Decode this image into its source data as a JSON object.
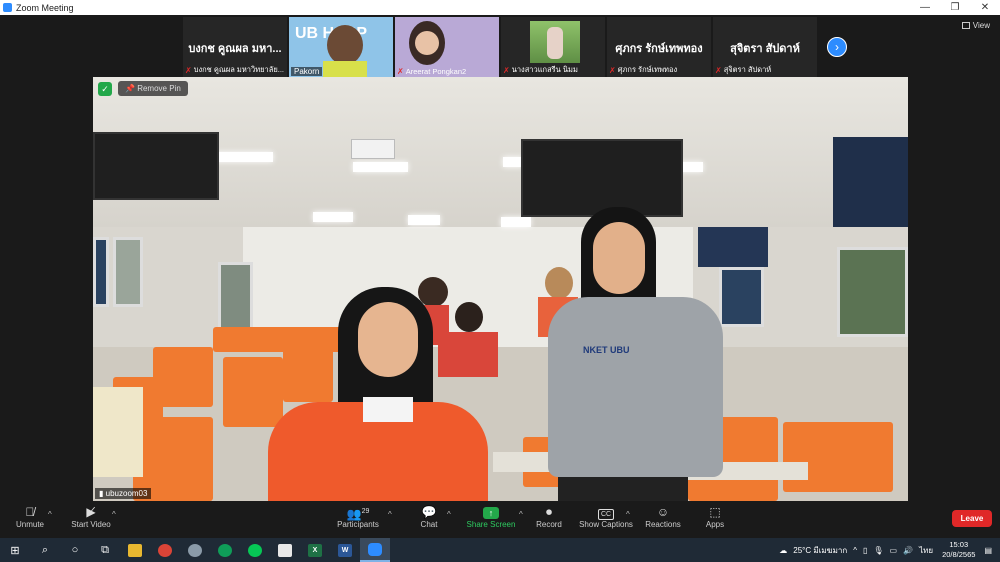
{
  "window": {
    "title": "Zoom Meeting",
    "minimize": "—",
    "maximize": "❐",
    "close": "✕"
  },
  "view_button": {
    "label": "View"
  },
  "strip": {
    "tiles": [
      {
        "name": "บงกช คูณผล มหา...",
        "footer": "บงกช คูณผล มหาวิทยาลัย...",
        "muted": true
      },
      {
        "name": "",
        "footer": "Pakorn",
        "muted": false,
        "badge": "UB HAPP"
      },
      {
        "name": "",
        "footer": "Areerat Pongkan2",
        "muted": true
      },
      {
        "name": "",
        "footer": "นางสาวแกสรีน นิมม",
        "muted": true
      },
      {
        "name": "ศุภกร รักษ์เทพทอง",
        "footer": "ศุภกร รักษ์เทพทอง",
        "muted": true
      },
      {
        "name": "สุจิตรา สัปดาห์",
        "footer": "สุจิตรา สัปดาห์",
        "muted": true
      }
    ],
    "next_icon": "›"
  },
  "main_video": {
    "remove_pin_label": "Remove Pin",
    "speaker_name": "ubuzoom03",
    "shirt_logo": "NKET UBU"
  },
  "toolbar": {
    "unmute": "Unmute",
    "start_video": "Start Video",
    "participants": "Participants",
    "participant_count": "29",
    "chat": "Chat",
    "share_screen": "Share Screen",
    "record": "Record",
    "show_captions": "Show Captions",
    "reactions": "Reactions",
    "apps": "Apps",
    "leave": "Leave",
    "captions_badge": "CC"
  },
  "taskbar": {
    "weather": "25°C มีเมฆมาก",
    "language": "ไทย",
    "time": "15:03",
    "date": "20/8/2565"
  }
}
